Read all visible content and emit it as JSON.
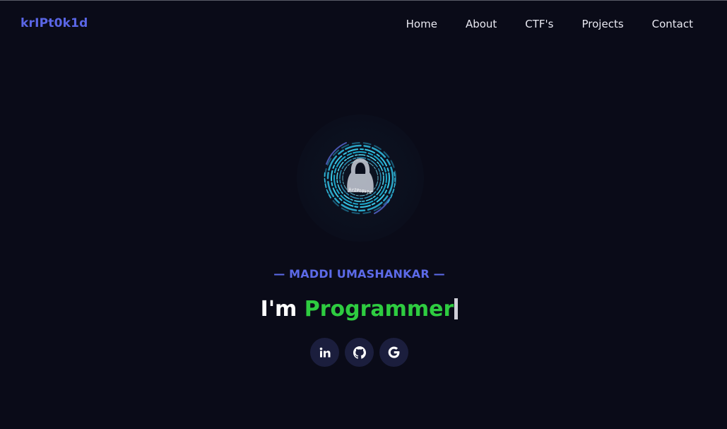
{
  "brand": {
    "name": "krIPt0k1d",
    "color": "#5a66e6"
  },
  "nav": {
    "items": [
      {
        "label": "Home"
      },
      {
        "label": "About"
      },
      {
        "label": "CTF's"
      },
      {
        "label": "Projects"
      },
      {
        "label": "Contact"
      }
    ]
  },
  "hero": {
    "avatar_label": "krIPt0k1d",
    "subtitle": "— MADDI UMASHANKAR —",
    "greeting": "I'm ",
    "role": "Programmer",
    "role_color": "#2ecc40",
    "subtitle_color": "#5c6ae8"
  },
  "socials": [
    {
      "icon": "linkedin-icon",
      "name": "linkedin"
    },
    {
      "icon": "github-icon",
      "name": "github"
    },
    {
      "icon": "google-icon",
      "name": "google"
    }
  ],
  "colors": {
    "background": "#0a0b18",
    "social_bg": "#1b1e3d",
    "avatar_accent": "#2fb6d8"
  }
}
